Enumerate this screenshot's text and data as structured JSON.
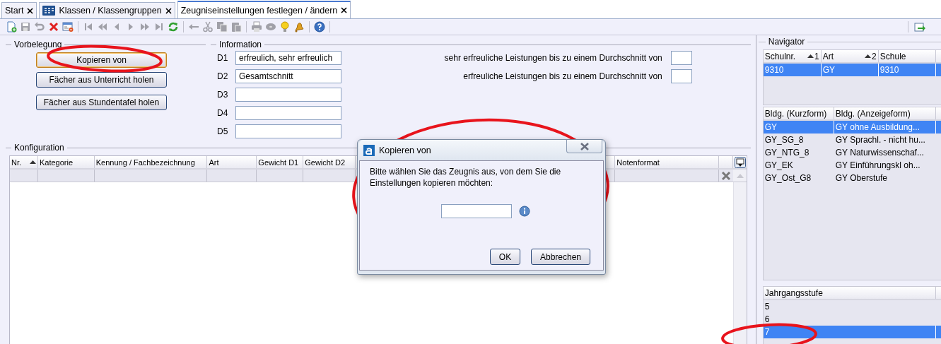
{
  "tabs": [
    {
      "label": "Start",
      "kind": "plain",
      "selected": false
    },
    {
      "label": "Klassen / Klassengruppen",
      "kind": "classes",
      "selected": false
    },
    {
      "label": "Zeugniseinstellungen festlegen / ändern",
      "kind": "plain",
      "selected": true
    }
  ],
  "toolbar": {
    "groups": [
      [
        {
          "kind": "new",
          "disabled": false
        },
        {
          "kind": "save",
          "disabled": true
        },
        {
          "kind": "undo",
          "disabled": true
        },
        {
          "kind": "delete",
          "disabled": false
        },
        {
          "kind": "form",
          "disabled": false
        }
      ],
      [
        {
          "kind": "first",
          "disabled": true
        },
        {
          "kind": "fast-back",
          "disabled": true
        },
        {
          "kind": "prev",
          "disabled": true
        },
        {
          "kind": "next",
          "disabled": true
        },
        {
          "kind": "fast-forward",
          "disabled": true
        },
        {
          "kind": "last",
          "disabled": true
        },
        {
          "kind": "refresh",
          "disabled": false
        }
      ],
      [
        {
          "kind": "back",
          "disabled": true
        },
        {
          "kind": "cut",
          "disabled": true
        },
        {
          "kind": "copy",
          "disabled": true
        },
        {
          "kind": "paste",
          "disabled": true
        }
      ],
      [
        {
          "kind": "print",
          "disabled": true
        },
        {
          "kind": "disc",
          "disabled": true
        },
        {
          "kind": "bulb",
          "disabled": false
        },
        {
          "kind": "bell",
          "disabled": false
        }
      ],
      [
        {
          "kind": "help",
          "disabled": false
        }
      ]
    ],
    "right": [
      {
        "kind": "export",
        "disabled": false
      }
    ]
  },
  "preset": {
    "title": "Vorbelegung",
    "buttons": [
      {
        "label": "Kopieren von",
        "focused": true
      },
      {
        "label": "Fächer aus Unterricht holen",
        "focused": false
      },
      {
        "label": "Fächer aus Stundentafel holen",
        "focused": false
      }
    ]
  },
  "information": {
    "title": "Information",
    "fields": [
      {
        "label": "D1",
        "value": "erfreulich, sehr erfreulich"
      },
      {
        "label": "D2",
        "value": "Gesamtschnitt"
      },
      {
        "label": "D3"
      },
      {
        "label": "D4"
      },
      {
        "label": "D5"
      }
    ],
    "thresholds": [
      {
        "label": "sehr erfreuliche Leistungen bis zu einem Durchschnitt von"
      },
      {
        "label": "erfreuliche Leistungen bis zu einem Durchschnitt von"
      }
    ]
  },
  "configuration": {
    "title": "Konfiguration",
    "columns": [
      {
        "label": "Nr.",
        "sorted": true
      },
      {
        "label": "Kategorie",
        "sorted": false
      },
      {
        "label": "Kennung / Fachbezeichnung",
        "sorted": false
      },
      {
        "label": "Art",
        "sorted": false
      },
      {
        "label": "Gewicht D1",
        "sorted": false
      },
      {
        "label": "Gewicht D2",
        "sorted": false
      },
      {
        "label": "Notenformat",
        "sorted": false
      }
    ]
  },
  "navigator": {
    "title": "Navigator",
    "schools": {
      "columns": [
        {
          "label": "Schulnr.",
          "sort_rank": "1"
        },
        {
          "label": "Art",
          "sort_rank": "2"
        },
        {
          "label": "Schule"
        }
      ],
      "rows": [
        {
          "cells": [
            "9310",
            "GY",
            "9310"
          ],
          "selected": true
        }
      ]
    },
    "programs": {
      "columns": [
        {
          "label": "Bldg. (Kurzform)"
        },
        {
          "label": "Bldg. (Anzeigeform)"
        }
      ],
      "rows": [
        {
          "cells": [
            "GY",
            "GY ohne Ausbildung..."
          ],
          "selected": true
        },
        {
          "cells": [
            "GY_SG_8",
            "GY Sprachl. - nicht hu..."
          ],
          "selected": false
        },
        {
          "cells": [
            "GY_NTG_8",
            "GY Naturwissenschaf..."
          ],
          "selected": false
        },
        {
          "cells": [
            "GY_EK",
            "GY Einführungskl oh..."
          ],
          "selected": false
        },
        {
          "cells": [
            "GY_Ost_G8",
            "GY Oberstufe"
          ],
          "selected": false
        }
      ]
    },
    "grades": {
      "columns": [
        {
          "label": "Jahrgangsstufe"
        }
      ],
      "rows": [
        {
          "cells": [
            "5"
          ],
          "selected": false
        },
        {
          "cells": [
            "6"
          ],
          "selected": false
        },
        {
          "cells": [
            "7"
          ],
          "selected": true
        }
      ]
    }
  },
  "dialog": {
    "title": "Kopieren von",
    "message": "Bitte wählen Sie das Zeugnis aus, von dem Sie die Einstellungen kopieren möchten:",
    "buttons": [
      {
        "label": "OK"
      },
      {
        "label": "Abbrechen"
      }
    ]
  },
  "annotations": [
    {
      "kind": "ellipse"
    },
    {
      "kind": "ellipse"
    },
    {
      "kind": "ellipse"
    }
  ]
}
